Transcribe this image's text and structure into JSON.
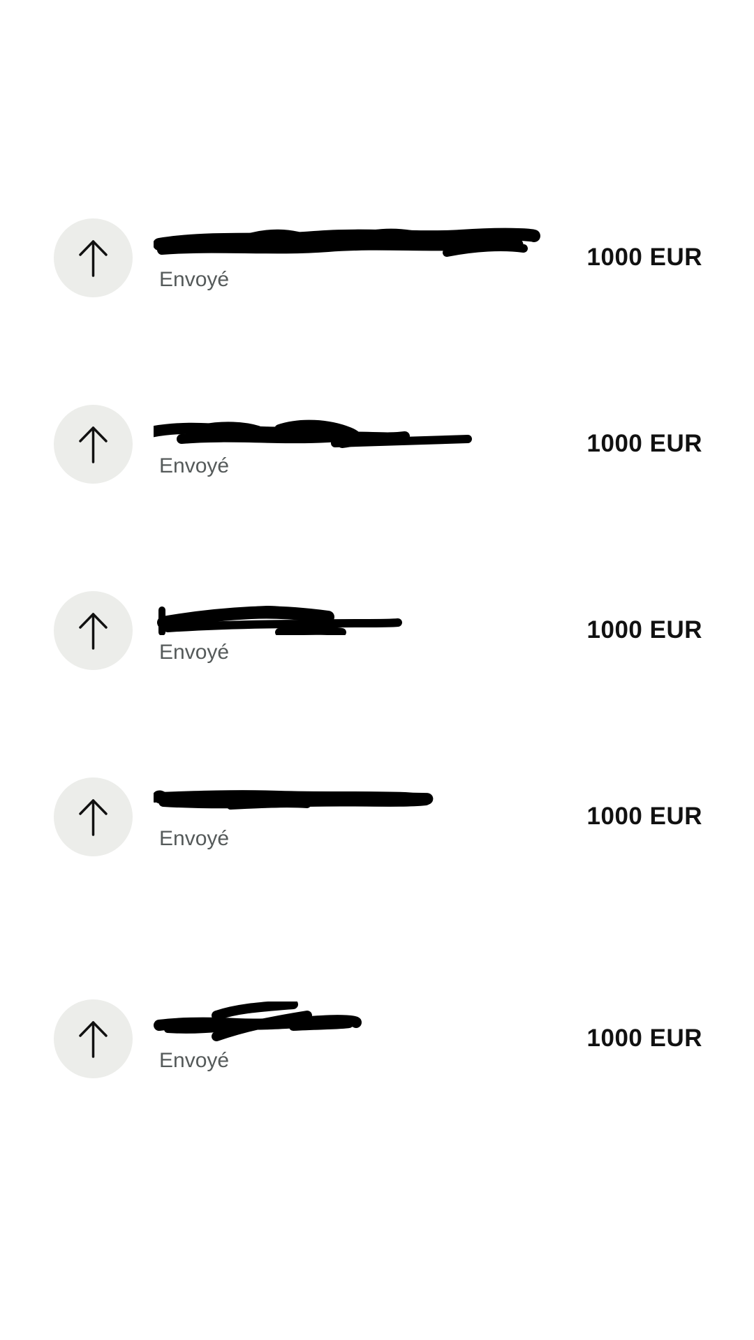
{
  "transactions": [
    {
      "name_redacted": true,
      "status": "Envoyé",
      "amount": "1000 EUR",
      "direction": "sent",
      "icon": "arrow-up-icon"
    },
    {
      "name_redacted": true,
      "status": "Envoyé",
      "amount": "1000 EUR",
      "direction": "sent",
      "icon": "arrow-up-icon"
    },
    {
      "name_redacted": true,
      "status": "Envoyé",
      "amount": "1000 EUR",
      "direction": "sent",
      "icon": "arrow-up-icon"
    },
    {
      "name_redacted": true,
      "status": "Envoyé",
      "amount": "1000 EUR",
      "direction": "sent",
      "icon": "arrow-up-icon"
    },
    {
      "name_redacted": true,
      "status": "Envoyé",
      "amount": "1000 EUR",
      "direction": "sent",
      "icon": "arrow-up-icon"
    }
  ],
  "colors": {
    "background": "#ffffff",
    "icon_circle": "#ecedea",
    "text_primary": "#111111",
    "text_secondary": "#555a5a",
    "redaction": "#000000"
  }
}
